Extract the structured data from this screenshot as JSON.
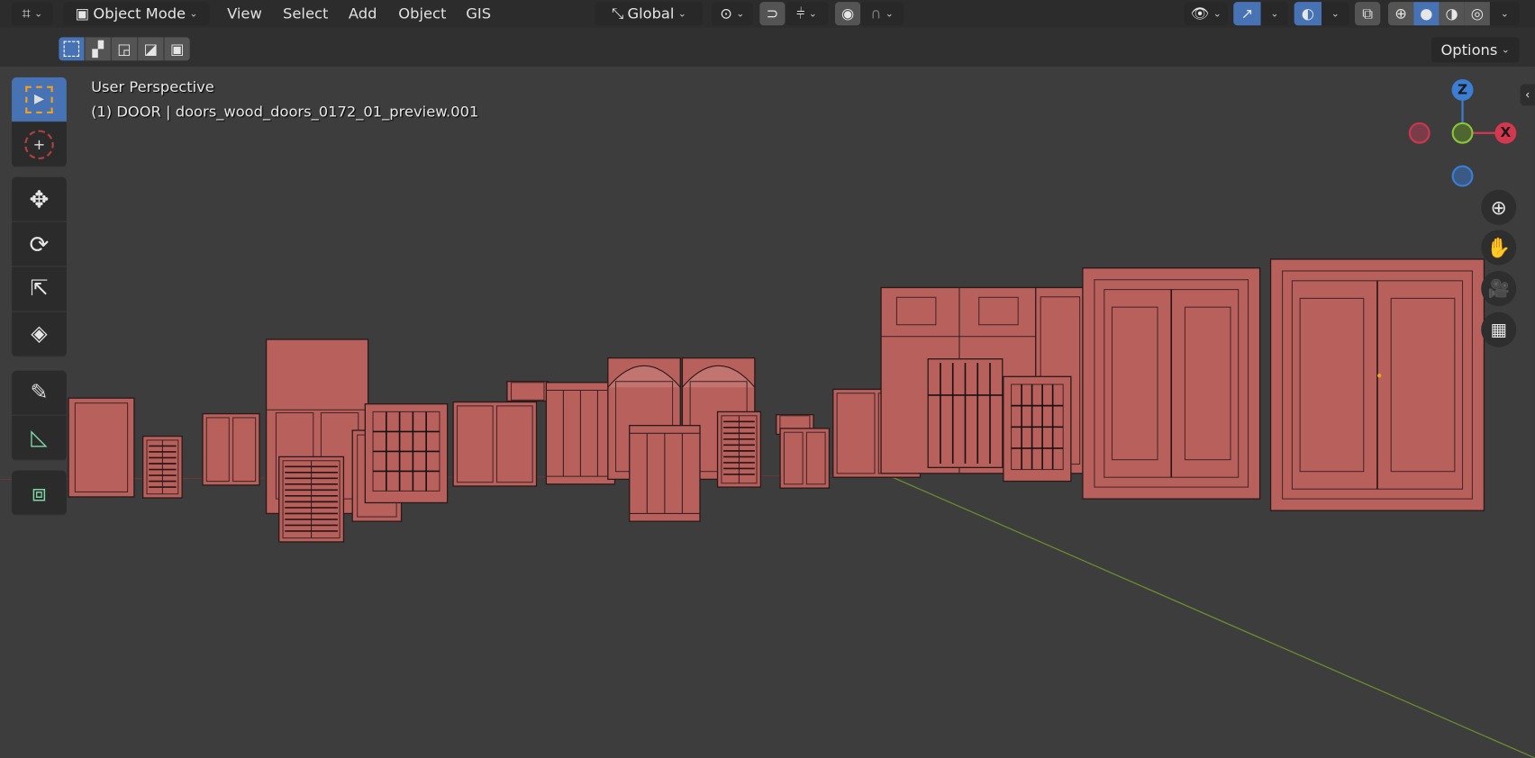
{
  "header": {
    "mode_label": "Object Mode",
    "menus": [
      "View",
      "Select",
      "Add",
      "Object",
      "GIS"
    ],
    "transform_orientation": "Global",
    "options_label": "Options"
  },
  "viewport": {
    "view_name": "User Perspective",
    "object_info": "(1) DOOR | doors_wood_doors_0172_01_preview.001"
  },
  "gizmo": {
    "z_label": "Z",
    "x_label": "X"
  },
  "colors": {
    "accent": "#4772b3",
    "door": "#b8605c",
    "x_axis": "#d4384e",
    "y_axis": "#8ac43a",
    "z_axis": "#3b7ed4"
  }
}
